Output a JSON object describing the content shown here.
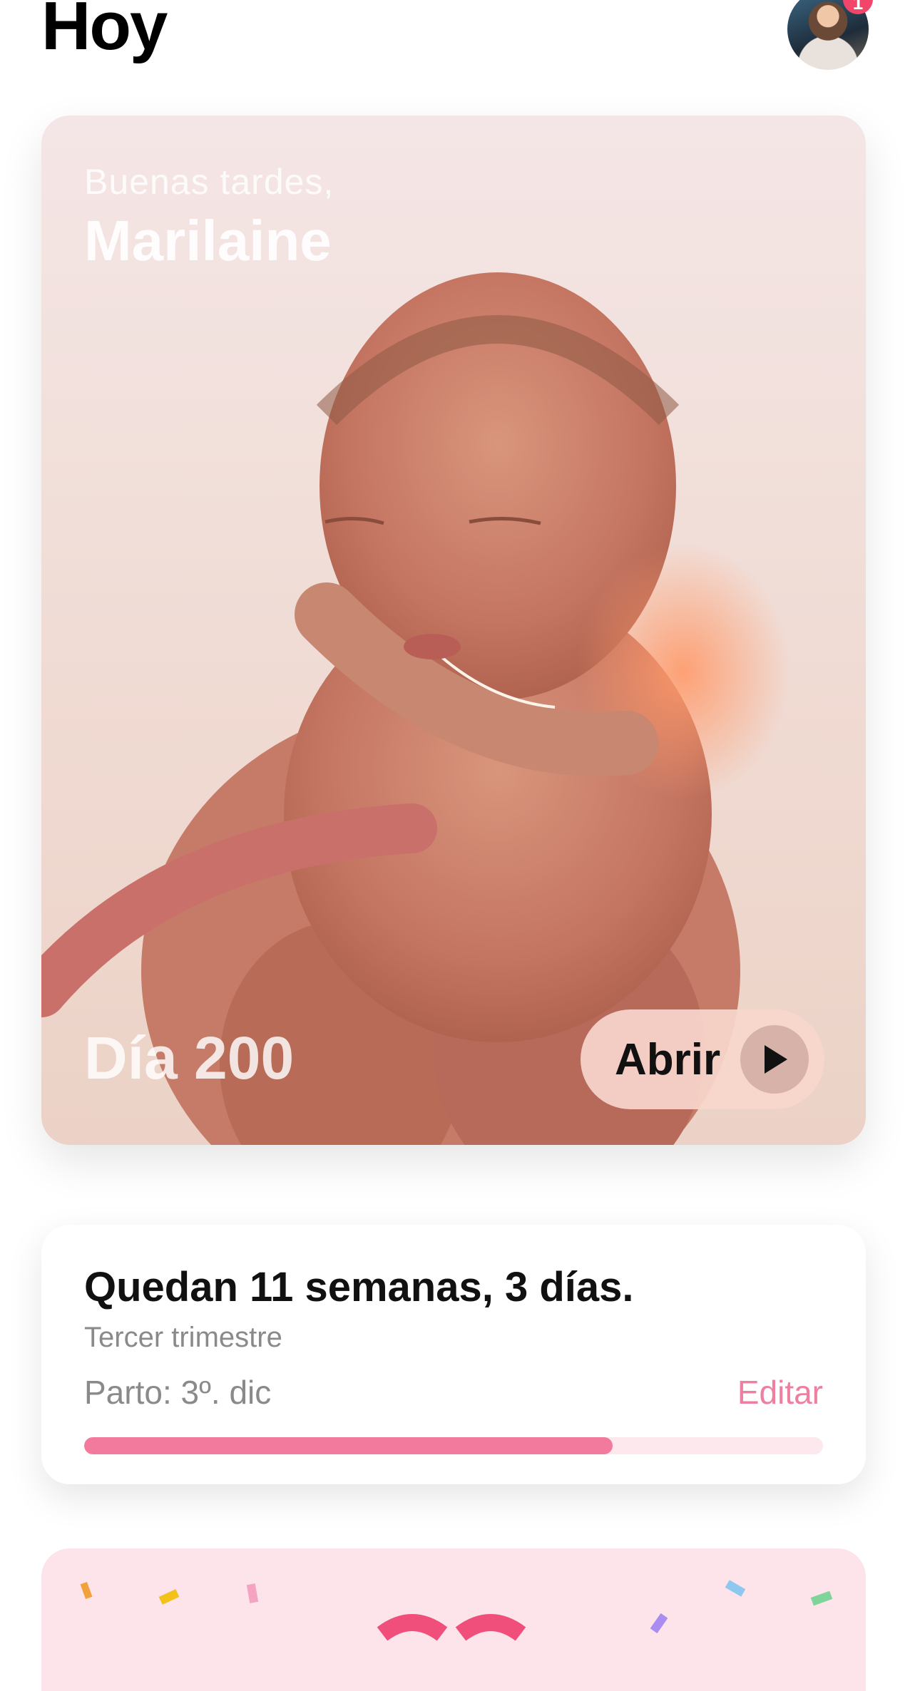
{
  "header": {
    "title": "Hoy",
    "notification_count": "1"
  },
  "hero": {
    "greeting": "Buenas tardes,",
    "user_name": "Marilaine",
    "day_label": "Día 200",
    "open_label": "Abrir"
  },
  "progress_card": {
    "weeks_left": "Quedan 11 semanas, 3 días.",
    "trimester": "Tercer trimestre",
    "due_date": "Parto: 3º. dic",
    "edit_label": "Editar",
    "progress_fraction": 0.715
  },
  "colors": {
    "accent_pink": "#f27a9c",
    "edit_pink": "#ef7fa0",
    "badge_red": "#f2456a",
    "celebration_bg": "#fde3ea"
  },
  "icons": {
    "play": "play-icon",
    "avatar": "profile-photo"
  }
}
